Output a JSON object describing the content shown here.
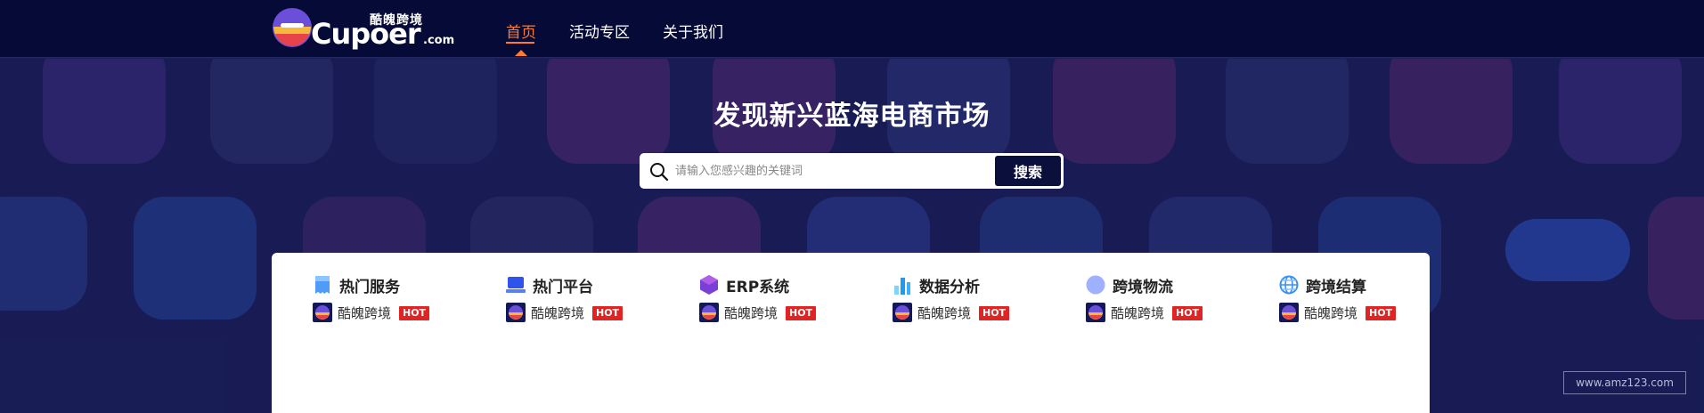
{
  "brand": {
    "cn_name": "酷魄跨境",
    "wordmark": "Cupoer",
    "domain_suffix": ".com"
  },
  "nav": {
    "items": [
      {
        "label": "首页",
        "active": true
      },
      {
        "label": "活动专区",
        "active": false
      },
      {
        "label": "关于我们",
        "active": false
      }
    ]
  },
  "hero": {
    "title": "发现新兴蓝海电商市场"
  },
  "search": {
    "placeholder": "请输入您感兴趣的关键词",
    "button_label": "搜索"
  },
  "categories": [
    {
      "title": "热门服务",
      "icon": "receipt-icon",
      "item_label": "酷魄跨境",
      "badge": "HOT"
    },
    {
      "title": "热门平台",
      "icon": "laptop-icon",
      "item_label": "酷魄跨境",
      "badge": "HOT"
    },
    {
      "title": "ERP系统",
      "icon": "cube-icon",
      "item_label": "酷魄跨境",
      "badge": "HOT"
    },
    {
      "title": "数据分析",
      "icon": "bar-chart-icon",
      "item_label": "酷魄跨境",
      "badge": "HOT"
    },
    {
      "title": "跨境物流",
      "icon": "circle-icon",
      "item_label": "酷魄跨境",
      "badge": "HOT"
    },
    {
      "title": "跨境结算",
      "icon": "globe-icon",
      "item_label": "酷魄跨境",
      "badge": "HOT"
    }
  ],
  "watermark": "www.amz123.com",
  "colors": {
    "header_bg": "#050a36",
    "accent": "#ff7a2e",
    "hero_bg": "#1c2057",
    "badge": "#e02424",
    "search_button": "#0b0f3c"
  }
}
